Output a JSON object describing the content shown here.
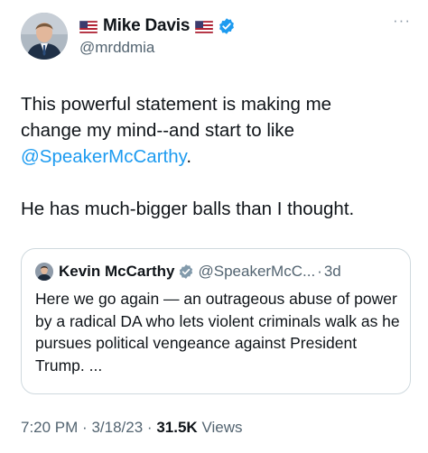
{
  "author": {
    "name": "Mike Davis",
    "handle": "@mrddmia",
    "verified": true,
    "name_flag_icon": "us-flag-icon",
    "avatar_icon": "profile-avatar"
  },
  "more_label": "···",
  "tweet": {
    "line1": "This powerful statement is making me",
    "line2": "change my mind--and start to like",
    "mention": "@SpeakerMcCarthy",
    "after_mention": ".",
    "line4": "He has much-bigger balls than I thought."
  },
  "quoted": {
    "name": "Kevin McCarthy",
    "handle": "@SpeakerMcC...",
    "separator": "·",
    "age": "3d",
    "verified": true,
    "text": "Here we go again — an outrageous abuse of power by a radical DA who lets violent criminals walk as he pursues political vengeance against President Trump. ..."
  },
  "meta": {
    "time": "7:20 PM",
    "sep1": "·",
    "date": "3/18/23",
    "sep2": "·",
    "views_count": "31.5K",
    "views_label": "Views"
  },
  "colors": {
    "link": "#1d9bf0",
    "text": "#0f1419",
    "secondary": "#536471",
    "border": "#cfd9de",
    "verified_badge": "#1d9bf0"
  }
}
